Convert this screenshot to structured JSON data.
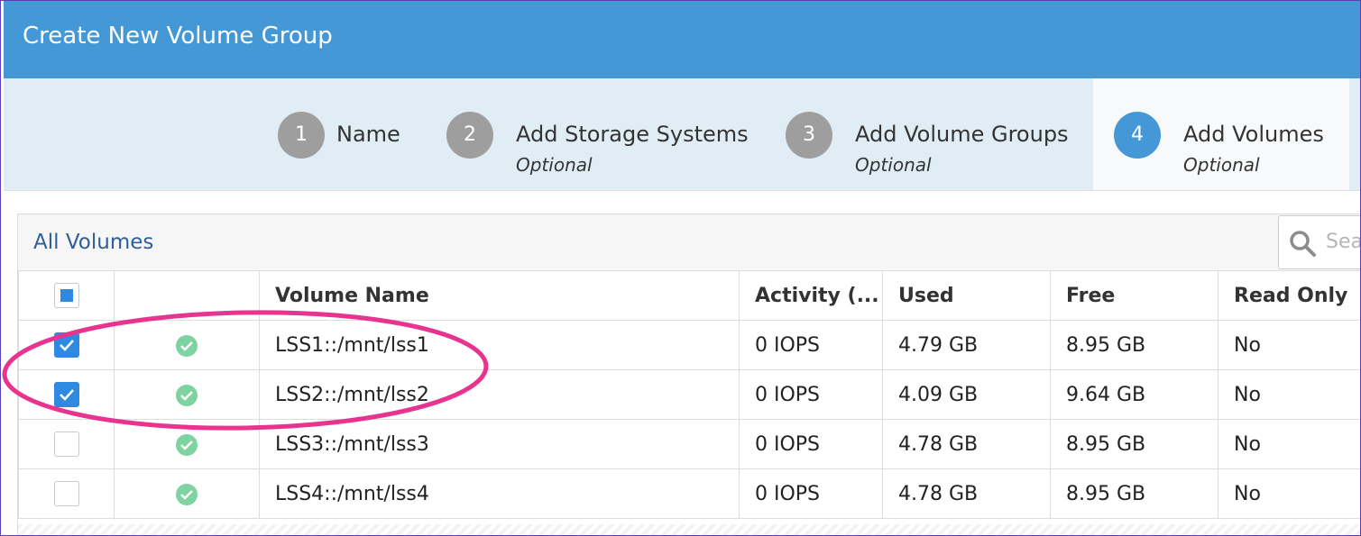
{
  "dialog": {
    "title": "Create New Volume Group"
  },
  "steps": [
    {
      "number": "1",
      "label": "Name",
      "sub": ""
    },
    {
      "number": "2",
      "label": "Add Storage Systems",
      "sub": "Optional"
    },
    {
      "number": "3",
      "label": "Add Volume Groups",
      "sub": "Optional"
    },
    {
      "number": "4",
      "label": "Add Volumes",
      "sub": "Optional"
    }
  ],
  "active_step": 4,
  "panel": {
    "title": "All Volumes",
    "search_placeholder": "Sea"
  },
  "table": {
    "columns": [
      "",
      "",
      "Volume Name",
      "Activity (...",
      "Used",
      "Free",
      "Read Only"
    ],
    "header_checkbox": "partial",
    "rows": [
      {
        "selected": true,
        "status": "ok-icon",
        "name": "LSS1::/mnt/lss1",
        "activity": "0 IOPS",
        "used": "4.79 GB",
        "free": "8.95 GB",
        "read_only": "No"
      },
      {
        "selected": true,
        "status": "ok-icon",
        "name": "LSS2::/mnt/lss2",
        "activity": "0 IOPS",
        "used": "4.09 GB",
        "free": "9.64 GB",
        "read_only": "No"
      },
      {
        "selected": false,
        "status": "ok-icon",
        "name": "LSS3::/mnt/lss3",
        "activity": "0 IOPS",
        "used": "4.78 GB",
        "free": "8.95 GB",
        "read_only": "No"
      },
      {
        "selected": false,
        "status": "ok-icon",
        "name": "LSS4::/mnt/lss4",
        "activity": "0 IOPS",
        "used": "4.78 GB",
        "free": "8.95 GB",
        "read_only": "No"
      }
    ]
  },
  "colors": {
    "header_blue": "#4498d6",
    "accent_blue": "#2d8ae0",
    "status_green": "#7ed3a0",
    "highlight_pink": "#e8338f"
  }
}
